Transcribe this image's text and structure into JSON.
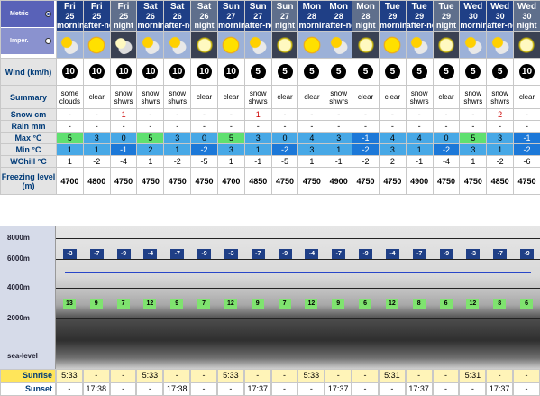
{
  "units": {
    "metric_label": "Metric",
    "imperial_label": "Imper.",
    "selected": "metric"
  },
  "columns": [
    {
      "day": "Fri",
      "date": "25",
      "period": "morning",
      "night": false,
      "icon": "partly-cloudy-icon",
      "wind": "10",
      "summary": "some clouds",
      "snow": "-",
      "rain": "-",
      "max": "5",
      "min": "1",
      "wchill": "1",
      "freezing": "4700"
    },
    {
      "day": "Fri",
      "date": "25",
      "period": "after-noon",
      "night": false,
      "icon": "sun-icon",
      "wind": "10",
      "summary": "clear",
      "snow": "-",
      "rain": "-",
      "max": "3",
      "min": "1",
      "wchill": "-2",
      "freezing": "4800"
    },
    {
      "day": "Fri",
      "date": "25",
      "period": "night",
      "night": true,
      "icon": "cloudy-night-icon",
      "wind": "10",
      "summary": "snow shwrs",
      "snow": "1",
      "rain": "-",
      "max": "0",
      "min": "-1",
      "wchill": "-4",
      "freezing": "4750"
    },
    {
      "day": "Sat",
      "date": "26",
      "period": "morning",
      "night": false,
      "icon": "partly-cloudy-icon",
      "wind": "10",
      "summary": "snow shwrs",
      "snow": "-",
      "rain": "-",
      "max": "5",
      "min": "2",
      "wchill": "1",
      "freezing": "4750"
    },
    {
      "day": "Sat",
      "date": "26",
      "period": "after-noon",
      "night": false,
      "icon": "partly-cloudy-icon",
      "wind": "10",
      "summary": "snow shwrs",
      "snow": "-",
      "rain": "-",
      "max": "3",
      "min": "1",
      "wchill": "-2",
      "freezing": "4750"
    },
    {
      "day": "Sat",
      "date": "26",
      "period": "night",
      "night": true,
      "icon": "moon-icon",
      "wind": "10",
      "summary": "clear",
      "snow": "-",
      "rain": "-",
      "max": "0",
      "min": "-2",
      "wchill": "-5",
      "freezing": "4750"
    },
    {
      "day": "Sun",
      "date": "27",
      "period": "morning",
      "night": false,
      "icon": "sun-icon",
      "wind": "10",
      "summary": "clear",
      "snow": "-",
      "rain": "-",
      "max": "5",
      "min": "3",
      "wchill": "1",
      "freezing": "4700"
    },
    {
      "day": "Sun",
      "date": "27",
      "period": "after-noon",
      "night": false,
      "icon": "partly-cloudy-icon",
      "wind": "5",
      "summary": "snow shwrs",
      "snow": "1",
      "rain": "-",
      "max": "3",
      "min": "1",
      "wchill": "-1",
      "freezing": "4850"
    },
    {
      "day": "Sun",
      "date": "27",
      "period": "night",
      "night": true,
      "icon": "moon-icon",
      "wind": "5",
      "summary": "clear",
      "snow": "-",
      "rain": "-",
      "max": "0",
      "min": "-2",
      "wchill": "-5",
      "freezing": "4750"
    },
    {
      "day": "Mon",
      "date": "28",
      "period": "morning",
      "night": false,
      "icon": "sun-icon",
      "wind": "5",
      "summary": "clear",
      "snow": "-",
      "rain": "-",
      "max": "4",
      "min": "3",
      "wchill": "1",
      "freezing": "4750"
    },
    {
      "day": "Mon",
      "date": "28",
      "period": "after-noon",
      "night": false,
      "icon": "partly-cloudy-icon",
      "wind": "5",
      "summary": "snow shwrs",
      "snow": "-",
      "rain": "-",
      "max": "3",
      "min": "1",
      "wchill": "-1",
      "freezing": "4900"
    },
    {
      "day": "Mon",
      "date": "28",
      "period": "night",
      "night": true,
      "icon": "moon-icon",
      "wind": "5",
      "summary": "clear",
      "snow": "-",
      "rain": "-",
      "max": "-1",
      "min": "-2",
      "wchill": "-2",
      "freezing": "4750"
    },
    {
      "day": "Tue",
      "date": "29",
      "period": "morning",
      "night": false,
      "icon": "sun-icon",
      "wind": "5",
      "summary": "clear",
      "snow": "-",
      "rain": "-",
      "max": "4",
      "min": "3",
      "wchill": "2",
      "freezing": "4750"
    },
    {
      "day": "Tue",
      "date": "29",
      "period": "after-noon",
      "night": false,
      "icon": "partly-cloudy-icon",
      "wind": "5",
      "summary": "snow shwrs",
      "snow": "-",
      "rain": "-",
      "max": "4",
      "min": "1",
      "wchill": "-1",
      "freezing": "4900"
    },
    {
      "day": "Tue",
      "date": "29",
      "period": "night",
      "night": true,
      "icon": "moon-icon",
      "wind": "5",
      "summary": "clear",
      "snow": "-",
      "rain": "-",
      "max": "0",
      "min": "-2",
      "wchill": "-4",
      "freezing": "4750"
    },
    {
      "day": "Wed",
      "date": "30",
      "period": "morning",
      "night": false,
      "icon": "partly-cloudy-icon",
      "wind": "5",
      "summary": "snow shwrs",
      "snow": "-",
      "rain": "-",
      "max": "5",
      "min": "3",
      "wchill": "1",
      "freezing": "4750"
    },
    {
      "day": "Wed",
      "date": "30",
      "period": "after-noon",
      "night": false,
      "icon": "partly-cloudy-icon",
      "wind": "5",
      "summary": "snow shwrs",
      "snow": "2",
      "rain": "-",
      "max": "3",
      "min": "1",
      "wchill": "-2",
      "freezing": "4850"
    },
    {
      "day": "Wed",
      "date": "30",
      "period": "night",
      "night": true,
      "icon": "moon-icon",
      "wind": "10",
      "summary": "clear",
      "snow": "-",
      "rain": "-",
      "max": "-1",
      "min": "-2",
      "wchill": "-6",
      "freezing": "4750"
    }
  ],
  "row_labels": {
    "wind": "Wind (km/h)",
    "summary": "Summary",
    "snow": "Snow cm",
    "rain": "Rain mm",
    "max": "Max °C",
    "min": "Min °C",
    "wchill": "WChill °C",
    "freezing": "Freezing level (m)"
  },
  "altitude_chart": {
    "labels": [
      "8000m",
      "6000m",
      "4000m",
      "2000m",
      "sea-level"
    ],
    "freezing_temps": [
      "-3",
      "-7",
      "-9",
      "-4",
      "-7",
      "-9",
      "-3",
      "-7",
      "-9",
      "-4",
      "-7",
      "-9",
      "-4",
      "-7",
      "-9",
      "-3",
      "-7",
      "-9"
    ],
    "ground_temps": [
      "13",
      "9",
      "7",
      "12",
      "9",
      "7",
      "12",
      "9",
      "7",
      "12",
      "9",
      "6",
      "12",
      "8",
      "6",
      "12",
      "8",
      "6"
    ]
  },
  "sunrise": {
    "label": "Sunrise",
    "values": [
      "5:33",
      "-",
      "-",
      "5:33",
      "-",
      "-",
      "5:33",
      "-",
      "-",
      "5:33",
      "-",
      "-",
      "5:31",
      "-",
      "-",
      "5:31",
      "-",
      "-"
    ]
  },
  "sunset": {
    "label": "Sunset",
    "values": [
      "-",
      "17:38",
      "-",
      "-",
      "17:38",
      "-",
      "-",
      "17:37",
      "-",
      "-",
      "17:37",
      "-",
      "-",
      "17:37",
      "-",
      "-",
      "17:37",
      "-"
    ]
  },
  "colors": {
    "header_day": "#1f3f86",
    "header_night": "#5f6f8c",
    "temp_cool": "#47a8e6",
    "temp_warm": "#5fe070",
    "temp_cold": "#1c78d8",
    "snow_label": "#c00",
    "rain_label": "#090"
  }
}
